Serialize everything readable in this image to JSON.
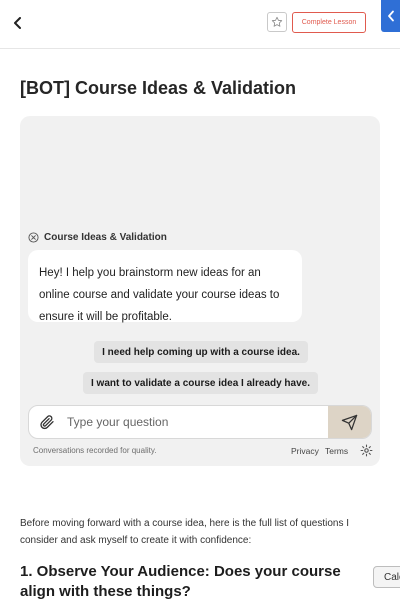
{
  "header": {
    "complete_label": "Complete Lesson"
  },
  "page": {
    "title": "[BOT] Course Ideas & Validation"
  },
  "chat": {
    "bot_name": "Course Ideas & Validation",
    "bot_message": "Hey! I help you brainstorm new ideas for an online course and validate your course ideas to ensure it will be profitable.",
    "suggestions": [
      "I need help coming up with a course idea.",
      "I want to validate a course idea I already have."
    ],
    "input_placeholder": "Type your question",
    "footer_note": "Conversations recorded for quality.",
    "privacy_label": "Privacy",
    "terms_label": "Terms"
  },
  "content": {
    "intro": "Before moving forward with a course idea, here is the full list of questions I consider and ask myself to create it with confidence:",
    "section_heading": "1. Observe Your Audience: Does your course align with these things?",
    "side_button_label": "Calc"
  },
  "icons": {
    "back": "chevron-left-icon",
    "favorite": "star-icon",
    "side_tab": "chevron-left-icon",
    "bot": "close-circle-icon",
    "attach": "paperclip-icon",
    "send": "send-icon",
    "settings": "gear-icon"
  },
  "colors": {
    "accent_red": "#e05a4e",
    "side_tab_blue": "#2f6fd6",
    "send_button": "#ddd4c6",
    "chat_panel": "#f1f1f1"
  }
}
